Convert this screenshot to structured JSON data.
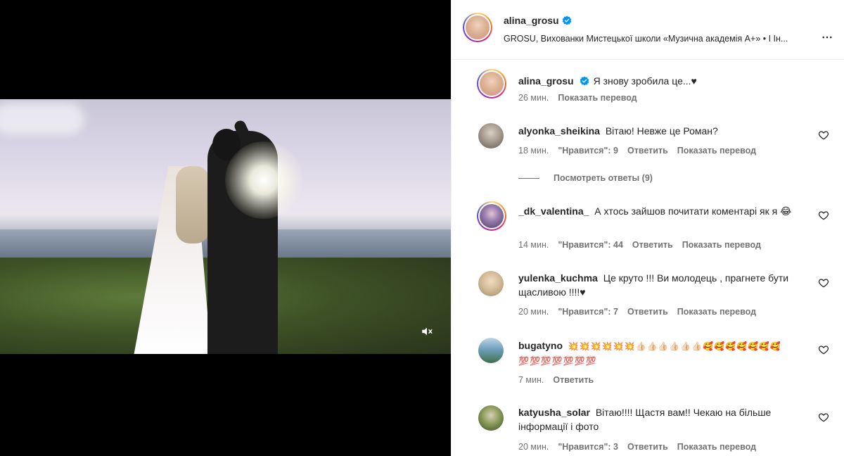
{
  "header": {
    "username": "alina_grosu",
    "subtitle": "GROSU, Вихованки Мистецької школи «Музична академія А+» • І Ін..."
  },
  "caption": {
    "username": "alina_grosu",
    "text": "Я знову зробила це...♥",
    "time": "26 мин.",
    "translate": "Показать перевод"
  },
  "comments": [
    {
      "username": "alyonka_sheikina",
      "text": "Вітаю! Невже це Роман?",
      "time": "18 мин.",
      "likes": "\"Нравится\": 9",
      "reply": "Ответить",
      "translate": "Показать перевод",
      "avatar_color": "#7a7268"
    },
    {
      "username": "_dk_valentina_",
      "text": "А хтось зайшов почитати коментарі як я 😂",
      "time": "14 мин.",
      "likes": "\"Нравится\": 44",
      "reply": "Ответить",
      "translate": "Показать перевод",
      "avatar_color": "#6d5a8a"
    },
    {
      "username": "yulenka_kuchma",
      "text": "Це круто !!! Ви молодець , прагнете бути щасливою !!!!♥",
      "time": "20 мин.",
      "likes": "\"Нравится\": 7",
      "reply": "Ответить",
      "translate": "Показать перевод",
      "avatar_color": "#c9b79a"
    },
    {
      "username": "bugatyno",
      "text": "💥💥💥💥💥💥👍🏻👍🏻👍🏻👍🏻👍🏻👍🏻🥰🥰🥰🥰🥰🥰🥰💯💯💯💯💯💯💯",
      "time": "7 мин.",
      "reply": "Ответить",
      "avatar_color": "#4e7fa0"
    },
    {
      "username": "katyusha_solar",
      "text": "Вітаю!!!! Щастя вам!! Чекаю на більше інформації і фото",
      "time": "20 мин.",
      "likes": "\"Нравится\": 3",
      "reply": "Ответить",
      "translate": "Показать перевод",
      "avatar_color": "#5a6b3a"
    }
  ],
  "view_replies": "Посмотреть ответы (9)",
  "colors": {
    "verified": "#0095f6",
    "meta": "#737373",
    "text": "#262626"
  },
  "icons": {
    "mute": "speaker-muted-icon",
    "more": "more-horizontal-icon",
    "like": "heart-outline-icon",
    "verified": "verified-badge-icon"
  }
}
